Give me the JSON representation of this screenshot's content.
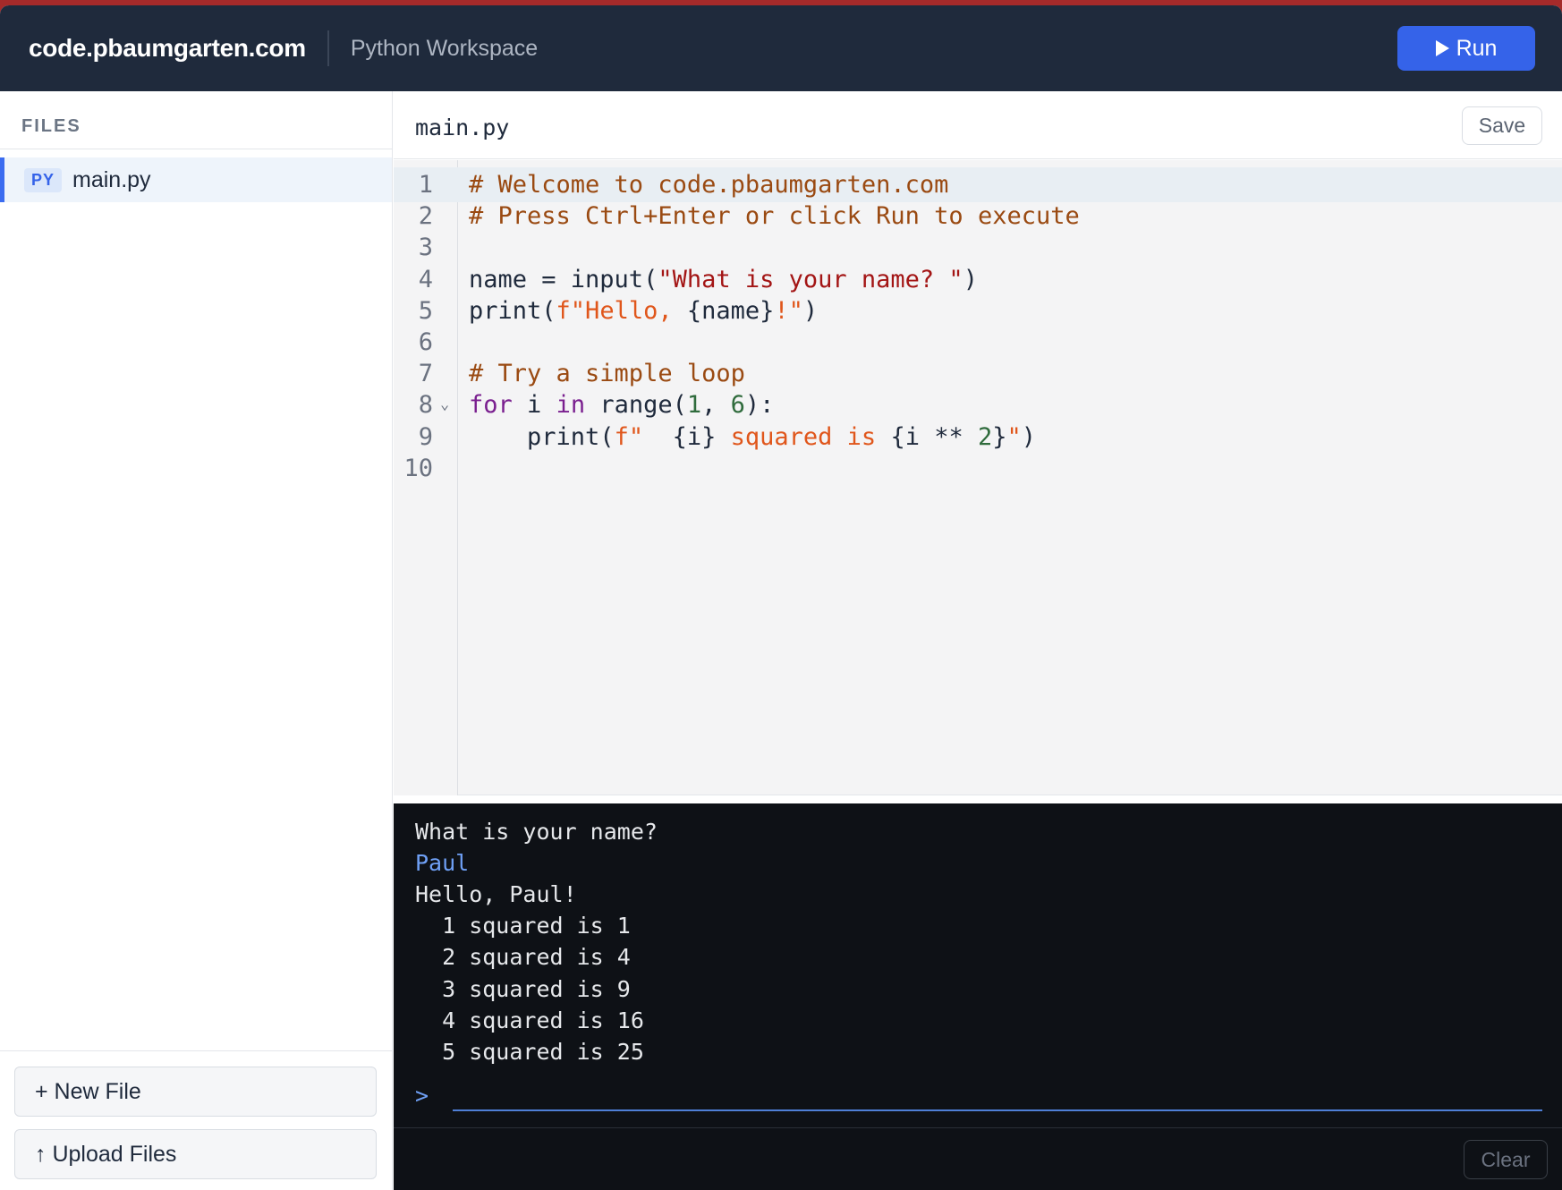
{
  "header": {
    "brand": "code.pbaumgarten.com",
    "workspace": "Python Workspace",
    "run_label": "Run"
  },
  "sidebar": {
    "heading": "FILES",
    "files": [
      {
        "badge": "PY",
        "name": "main.py"
      }
    ],
    "new_file_label": "+ New File",
    "upload_label": "↑ Upload Files"
  },
  "editor": {
    "tab_name": "main.py",
    "save_label": "Save",
    "lines": [
      {
        "n": "1",
        "segs": [
          [
            "com",
            "# Welcome to code.pbaumgarten.com"
          ]
        ]
      },
      {
        "n": "2",
        "segs": [
          [
            "com",
            "# Press Ctrl+Enter or click Run to execute"
          ]
        ]
      },
      {
        "n": "3",
        "segs": []
      },
      {
        "n": "4",
        "segs": [
          [
            "plain",
            "name = input("
          ],
          [
            "str",
            "\"What is your name? \""
          ],
          [
            "plain",
            ")"
          ]
        ]
      },
      {
        "n": "5",
        "segs": [
          [
            "plain",
            "print("
          ],
          [
            "fstr",
            "f\"Hello, "
          ],
          [
            "plain",
            "{name}"
          ],
          [
            "fstr",
            "!\""
          ],
          [
            "plain",
            ")"
          ]
        ]
      },
      {
        "n": "6",
        "segs": []
      },
      {
        "n": "7",
        "segs": [
          [
            "com",
            "# Try a simple loop"
          ]
        ]
      },
      {
        "n": "8",
        "segs": [
          [
            "kw",
            "for"
          ],
          [
            "plain",
            " i "
          ],
          [
            "kw",
            "in"
          ],
          [
            "plain",
            " range("
          ],
          [
            "num",
            "1"
          ],
          [
            "plain",
            ", "
          ],
          [
            "num",
            "6"
          ],
          [
            "plain",
            "):"
          ]
        ]
      },
      {
        "n": "9",
        "segs": [
          [
            "plain",
            "    print("
          ],
          [
            "fstr",
            "f\"  "
          ],
          [
            "plain",
            "{i}"
          ],
          [
            "fstr",
            " squared is "
          ],
          [
            "plain",
            "{i ** "
          ],
          [
            "num",
            "2"
          ],
          [
            "plain",
            "}"
          ],
          [
            "fstr",
            "\""
          ],
          [
            "plain",
            ")"
          ]
        ]
      },
      {
        "n": "10",
        "segs": []
      }
    ]
  },
  "terminal": {
    "lines": [
      {
        "text": "What is your name?",
        "input": false
      },
      {
        "text": "Paul",
        "input": true
      },
      {
        "text": "Hello, Paul!",
        "input": false
      },
      {
        "text": "  1 squared is 1",
        "input": false
      },
      {
        "text": "  2 squared is 4",
        "input": false
      },
      {
        "text": "  3 squared is 9",
        "input": false
      },
      {
        "text": "  4 squared is 16",
        "input": false
      },
      {
        "text": "  5 squared is 25",
        "input": false
      }
    ],
    "prompt": ">",
    "input_value": "",
    "clear_label": "Clear"
  },
  "colors": {
    "header_bg": "#1f2a3c",
    "accent": "#3563e9",
    "terminal_bg": "#0e1116",
    "terminal_input_text": "#6fa0f5",
    "comment": "#9a4a12",
    "string": "#a31515",
    "fstring": "#e0561b",
    "number": "#2f6b3c",
    "keyword": "#7a1f8f"
  },
  "icons": {
    "run": "play-icon",
    "fold": "chevron-down-icon"
  }
}
